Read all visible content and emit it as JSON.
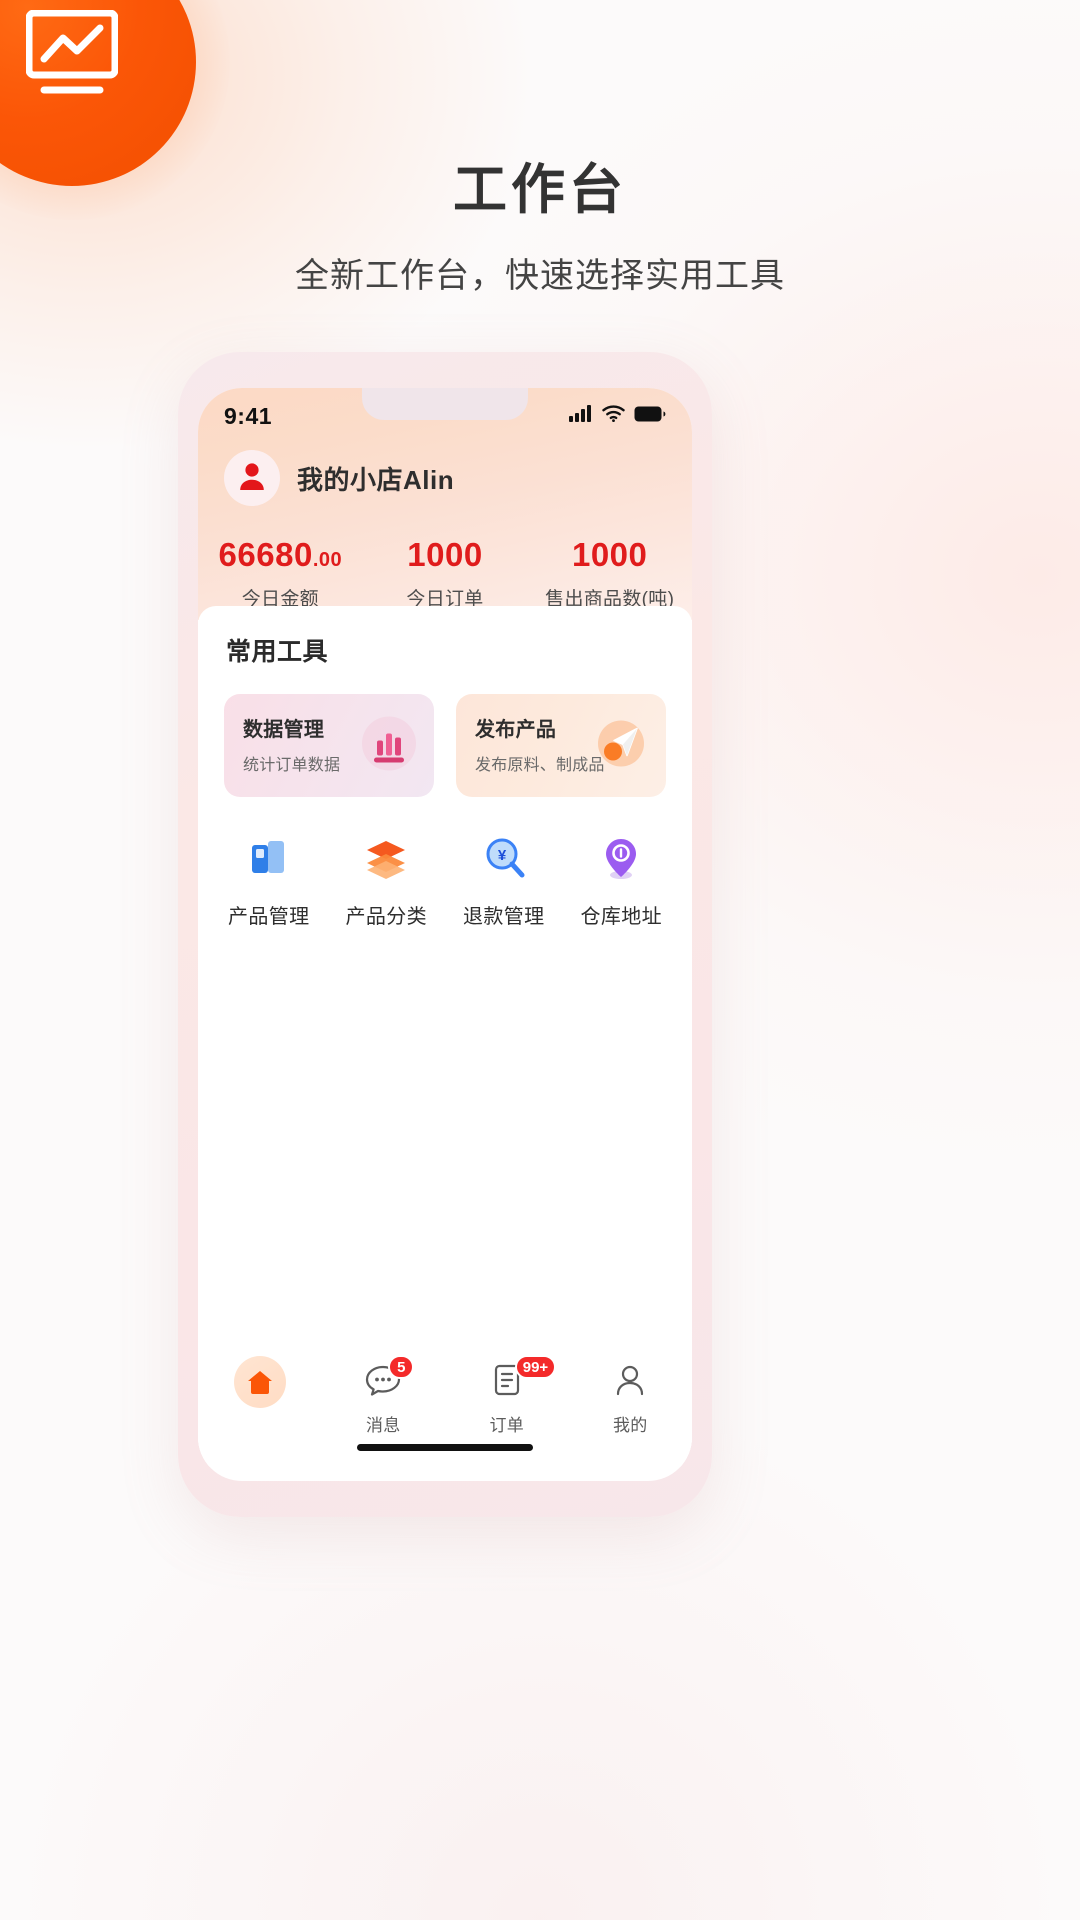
{
  "brand": {
    "accent_orange": "#fb5607",
    "accent_red": "#e01c1c",
    "logo_icon": "chart-monitor-icon"
  },
  "hero": {
    "title": "工作台",
    "subtitle": "全新工作台，快速选择实用工具"
  },
  "phone": {
    "statusbar": {
      "time": "9:41",
      "icons": [
        "signal-icon",
        "wifi-icon",
        "battery-icon"
      ]
    },
    "profile": {
      "avatar_icon": "user-avatar-icon",
      "shop_name": "我的小店Alin"
    },
    "stats": [
      {
        "value": "66680",
        "cents": ".00",
        "label": "今日金额"
      },
      {
        "value": "1000",
        "cents": "",
        "label": "今日订单"
      },
      {
        "value": "1000",
        "cents": "",
        "label": "售出商品数(吨)"
      }
    ],
    "tools_section": {
      "title": "常用工具",
      "feature_cards": [
        {
          "title": "数据管理",
          "subtitle": "统计订单数据",
          "icon": "data-chart-icon"
        },
        {
          "title": "发布产品",
          "subtitle": "发布原料、制成品",
          "icon": "publish-send-icon"
        }
      ],
      "grid_items": [
        {
          "label": "产品管理",
          "icon": "product-book-icon"
        },
        {
          "label": "产品分类",
          "icon": "layers-category-icon"
        },
        {
          "label": "退款管理",
          "icon": "refund-search-icon"
        },
        {
          "label": "仓库地址",
          "icon": "warehouse-location-icon"
        }
      ]
    },
    "tabbar": [
      {
        "label": "",
        "icon": "home-icon",
        "badge": "",
        "active": true
      },
      {
        "label": "消息",
        "icon": "message-icon",
        "badge": "5",
        "active": false
      },
      {
        "label": "订单",
        "icon": "order-list-icon",
        "badge": "99+",
        "active": false
      },
      {
        "label": "我的",
        "icon": "profile-person-icon",
        "badge": "",
        "active": false
      }
    ]
  }
}
